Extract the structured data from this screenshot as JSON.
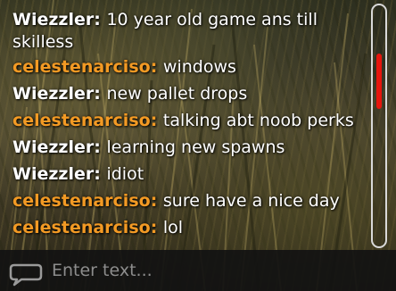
{
  "chat": {
    "messages": [
      {
        "sender": "Wiezzler",
        "type": "me",
        "text": "10 year old game ans till skilless"
      },
      {
        "sender": "celestenarciso",
        "type": "other",
        "text": "windows"
      },
      {
        "sender": "Wiezzler",
        "type": "me",
        "text": "new pallet drops"
      },
      {
        "sender": "celestenarciso",
        "type": "other",
        "text": "talking abt noob perks"
      },
      {
        "sender": "Wiezzler",
        "type": "me",
        "text": "learning new spawns"
      },
      {
        "sender": "Wiezzler",
        "type": "me",
        "text": "idiot"
      },
      {
        "sender": "celestenarciso",
        "type": "other",
        "text": "sure have a nice day"
      },
      {
        "sender": "celestenarciso",
        "type": "other",
        "text": "lol"
      }
    ]
  },
  "input": {
    "placeholder": "Enter text...",
    "value": ""
  },
  "icons": {
    "input_icon": "chat-bubble-icon"
  },
  "colors": {
    "self_name": "#ffffff",
    "other_name": "#f39a24",
    "scroll_thumb": "#e8150d",
    "scroll_track_border": "#d9d9d9",
    "input_bar": "#121212",
    "placeholder": "#8d8d8d"
  }
}
